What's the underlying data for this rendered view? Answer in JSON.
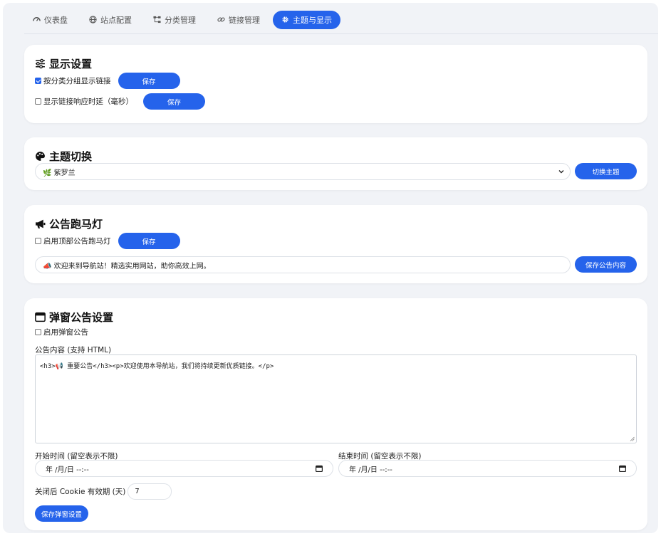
{
  "tabs": [
    {
      "label": "仪表盘",
      "icon": "gauge-icon"
    },
    {
      "label": "站点配置",
      "icon": "globe-icon"
    },
    {
      "label": "分类管理",
      "icon": "sitemap-icon"
    },
    {
      "label": "链接管理",
      "icon": "link-icon"
    },
    {
      "label": "主题与显示",
      "icon": "gear-icon",
      "active": true
    }
  ],
  "display": {
    "title": "显示设置",
    "group_label": "按分类分组显示链接",
    "group_checked": true,
    "latency_label": "显示链接响应时延（毫秒）",
    "latency_checked": false,
    "save_label": "保存"
  },
  "theme": {
    "title": "主题切换",
    "selected": "🌿 紫罗兰",
    "switch_label": "切换主题"
  },
  "marquee": {
    "title": "公告跑马灯",
    "enable_label": "启用顶部公告跑马灯",
    "enable_checked": false,
    "save_label": "保存",
    "content": "📣 欢迎来到导航站！精选实用网站，助你高效上网。",
    "save_content_label": "保存公告内容"
  },
  "popup": {
    "title": "弹窗公告设置",
    "enable_label": "启用弹窗公告",
    "enable_checked": false,
    "content_label": "公告内容 (支持 HTML)",
    "content": "<h3>📢 重要公告</h3><p>欢迎使用本导航站，我们将持续更新优质链接。</p>",
    "start_label": "开始时间 (留空表示不限)",
    "end_label": "结束时间 (留空表示不限)",
    "date_placeholder": "年 /月/日 --:--",
    "cookie_label": "关闭后 Cookie 有效期 (天)",
    "cookie_value": "7",
    "save_label": "保存弹窗设置"
  },
  "colors": {
    "accent": "#2563eb",
    "background": "#f1f3f7"
  }
}
